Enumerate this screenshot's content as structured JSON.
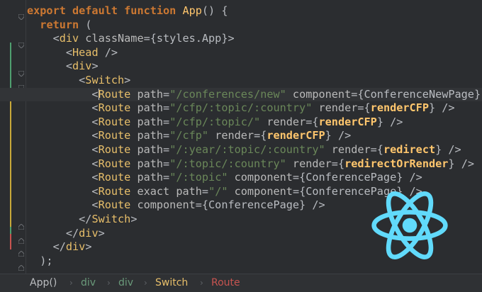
{
  "editor": {
    "lines": [
      {
        "tokens": [
          {
            "t": "export default function",
            "c": "kw"
          },
          {
            "t": " ",
            "c": "plain"
          },
          {
            "t": "App",
            "c": "fn"
          },
          {
            "t": "() {",
            "c": "plain"
          }
        ]
      },
      {
        "tokens": [
          {
            "t": "  ",
            "c": "plain"
          },
          {
            "t": "return",
            "c": "kw"
          },
          {
            "t": " (",
            "c": "plain"
          }
        ]
      },
      {
        "tokens": [
          {
            "t": "    <",
            "c": "plain"
          },
          {
            "t": "div",
            "c": "tag"
          },
          {
            "t": " className",
            "c": "attr"
          },
          {
            "t": "={styles.App}>",
            "c": "plain"
          }
        ]
      },
      {
        "tokens": [
          {
            "t": "      <",
            "c": "plain"
          },
          {
            "t": "Head",
            "c": "tag"
          },
          {
            "t": " />",
            "c": "plain"
          }
        ]
      },
      {
        "tokens": [
          {
            "t": "      <",
            "c": "plain"
          },
          {
            "t": "div",
            "c": "tag"
          },
          {
            "t": ">",
            "c": "plain"
          }
        ]
      },
      {
        "tokens": [
          {
            "t": "        <",
            "c": "plain"
          },
          {
            "t": "Switch",
            "c": "tag"
          },
          {
            "t": ">",
            "c": "plain"
          }
        ]
      },
      {
        "tokens": [
          {
            "t": "          <",
            "c": "plain"
          },
          {
            "t": "Route",
            "c": "tag"
          },
          {
            "t": " path",
            "c": "attr"
          },
          {
            "t": "=",
            "c": "plain"
          },
          {
            "t": "\"/conferences/new\"",
            "c": "str"
          },
          {
            "t": " component",
            "c": "attr"
          },
          {
            "t": "={ConferenceNewPage}",
            "c": "plain"
          }
        ],
        "current": true
      },
      {
        "tokens": [
          {
            "t": "          <",
            "c": "plain"
          },
          {
            "t": "Route",
            "c": "tag"
          },
          {
            "t": " path",
            "c": "attr"
          },
          {
            "t": "=",
            "c": "plain"
          },
          {
            "t": "\"/cfp/:topic/:country\"",
            "c": "str"
          },
          {
            "t": " render",
            "c": "attr"
          },
          {
            "t": "={",
            "c": "plain"
          },
          {
            "t": "renderCFP",
            "c": "ref"
          },
          {
            "t": "} />",
            "c": "plain"
          }
        ]
      },
      {
        "tokens": [
          {
            "t": "          <",
            "c": "plain"
          },
          {
            "t": "Route",
            "c": "tag"
          },
          {
            "t": " path",
            "c": "attr"
          },
          {
            "t": "=",
            "c": "plain"
          },
          {
            "t": "\"/cfp/:topic/\"",
            "c": "str"
          },
          {
            "t": " render",
            "c": "attr"
          },
          {
            "t": "={",
            "c": "plain"
          },
          {
            "t": "renderCFP",
            "c": "ref"
          },
          {
            "t": "} />",
            "c": "plain"
          }
        ]
      },
      {
        "tokens": [
          {
            "t": "          <",
            "c": "plain"
          },
          {
            "t": "Route",
            "c": "tag"
          },
          {
            "t": " path",
            "c": "attr"
          },
          {
            "t": "=",
            "c": "plain"
          },
          {
            "t": "\"/cfp\"",
            "c": "str"
          },
          {
            "t": " render",
            "c": "attr"
          },
          {
            "t": "={",
            "c": "plain"
          },
          {
            "t": "renderCFP",
            "c": "ref"
          },
          {
            "t": "} />",
            "c": "plain"
          }
        ]
      },
      {
        "tokens": [
          {
            "t": "          <",
            "c": "plain"
          },
          {
            "t": "Route",
            "c": "tag"
          },
          {
            "t": " path",
            "c": "attr"
          },
          {
            "t": "=",
            "c": "plain"
          },
          {
            "t": "\"/:year/:topic/:country\"",
            "c": "str"
          },
          {
            "t": " render",
            "c": "attr"
          },
          {
            "t": "={",
            "c": "plain"
          },
          {
            "t": "redirect",
            "c": "ref"
          },
          {
            "t": "} />",
            "c": "plain"
          }
        ]
      },
      {
        "tokens": [
          {
            "t": "          <",
            "c": "plain"
          },
          {
            "t": "Route",
            "c": "tag"
          },
          {
            "t": " path",
            "c": "attr"
          },
          {
            "t": "=",
            "c": "plain"
          },
          {
            "t": "\"/:topic/:country\"",
            "c": "str"
          },
          {
            "t": " render",
            "c": "attr"
          },
          {
            "t": "={",
            "c": "plain"
          },
          {
            "t": "redirectOrRender",
            "c": "ref"
          },
          {
            "t": "} />",
            "c": "plain"
          }
        ]
      },
      {
        "tokens": [
          {
            "t": "          <",
            "c": "plain"
          },
          {
            "t": "Route",
            "c": "tag"
          },
          {
            "t": " path",
            "c": "attr"
          },
          {
            "t": "=",
            "c": "plain"
          },
          {
            "t": "\"/:topic\"",
            "c": "str"
          },
          {
            "t": " component",
            "c": "attr"
          },
          {
            "t": "={ConferencePage} />",
            "c": "plain"
          }
        ]
      },
      {
        "tokens": [
          {
            "t": "          <",
            "c": "plain"
          },
          {
            "t": "Route",
            "c": "tag"
          },
          {
            "t": " exact path",
            "c": "attr"
          },
          {
            "t": "=",
            "c": "plain"
          },
          {
            "t": "\"/\"",
            "c": "str"
          },
          {
            "t": " component",
            "c": "attr"
          },
          {
            "t": "={ConferencePage} />",
            "c": "plain"
          }
        ]
      },
      {
        "tokens": [
          {
            "t": "          <",
            "c": "plain"
          },
          {
            "t": "Route",
            "c": "tag"
          },
          {
            "t": " component",
            "c": "attr"
          },
          {
            "t": "={ConferencePage} />",
            "c": "plain"
          }
        ]
      },
      {
        "tokens": [
          {
            "t": "        </",
            "c": "plain"
          },
          {
            "t": "Switch",
            "c": "tag"
          },
          {
            "t": ">",
            "c": "plain"
          }
        ]
      },
      {
        "tokens": [
          {
            "t": "      </",
            "c": "plain"
          },
          {
            "t": "div",
            "c": "tag"
          },
          {
            "t": ">",
            "c": "plain"
          }
        ]
      },
      {
        "tokens": [
          {
            "t": "    </",
            "c": "plain"
          },
          {
            "t": "div",
            "c": "tag"
          },
          {
            "t": ">",
            "c": "plain"
          }
        ]
      },
      {
        "tokens": [
          {
            "t": "  );",
            "c": "plain"
          }
        ]
      }
    ],
    "caret_line": 6
  },
  "breadcrumbs": [
    {
      "label": "App()",
      "color": "#bcbec1"
    },
    {
      "label": "div",
      "color": "#6a9a7a"
    },
    {
      "label": "div",
      "color": "#6a9a7a"
    },
    {
      "label": "Switch",
      "color": "#e8bf6a"
    },
    {
      "label": "Route",
      "color": "#c75450"
    }
  ],
  "logo": {
    "icon": "react-logo-icon",
    "color": "#61dafb"
  },
  "gutter": {
    "modified_color": "#4f9f6f",
    "changed_color": "#c8a83a",
    "deleted_color": "#c75450"
  }
}
